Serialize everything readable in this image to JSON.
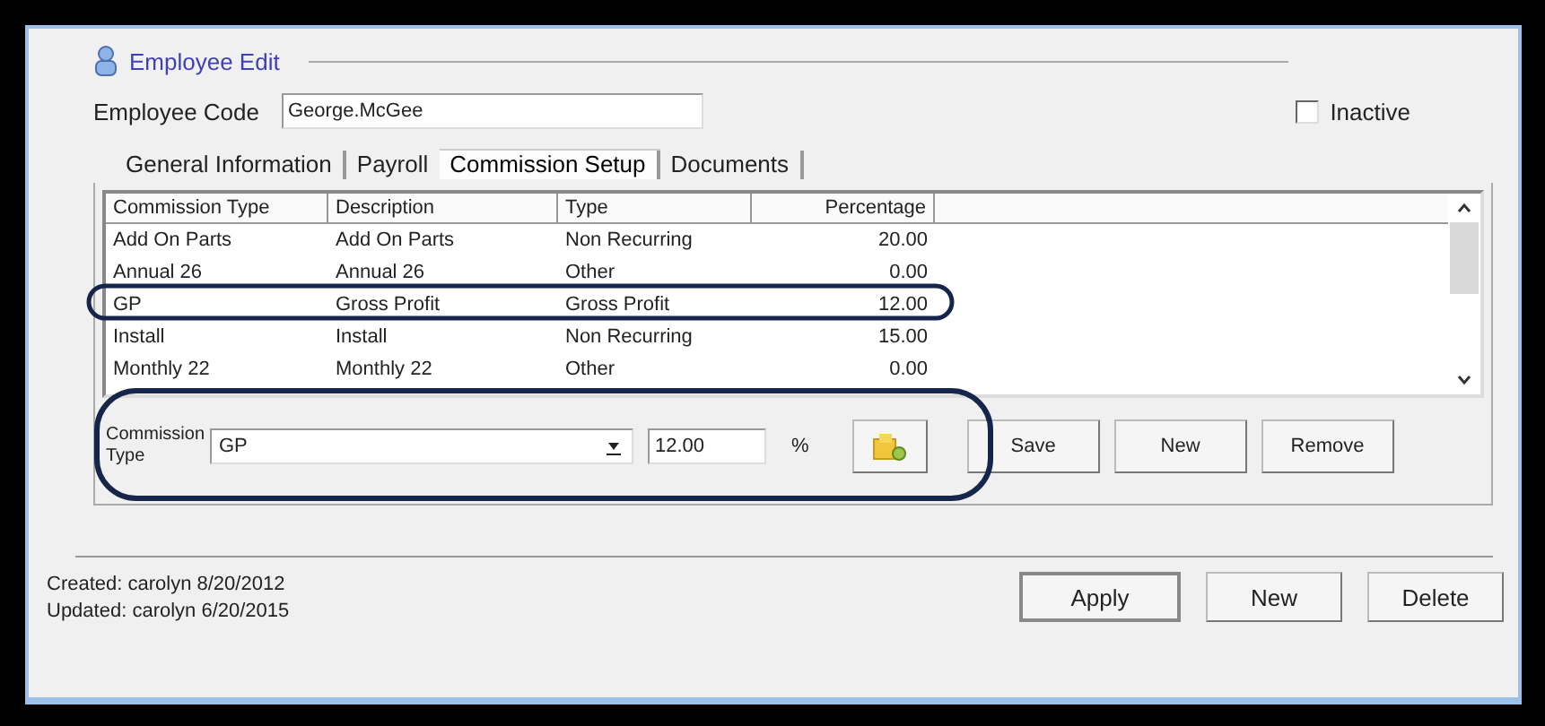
{
  "window": {
    "title": "Employee Edit"
  },
  "employee_code": {
    "label": "Employee Code",
    "value": "George.McGee"
  },
  "inactive": {
    "label": "Inactive",
    "checked": false
  },
  "tabs": [
    {
      "label": "General Information",
      "selected": false
    },
    {
      "label": "Payroll",
      "selected": false
    },
    {
      "label": "Commission Setup",
      "selected": true
    },
    {
      "label": "Documents",
      "selected": false
    }
  ],
  "table": {
    "columns": [
      "Commission Type",
      "Description",
      "Type",
      "Percentage"
    ],
    "rows": [
      [
        "Add On Parts",
        "Add On Parts",
        "Non Recurring",
        "20.00"
      ],
      [
        "Annual 26",
        "Annual 26",
        "Other",
        "0.00"
      ],
      [
        "GP",
        "Gross Profit",
        "Gross Profit",
        "12.00"
      ],
      [
        "Install",
        "Install",
        "Non Recurring",
        "15.00"
      ],
      [
        "Monthly 22",
        "Monthly 22",
        "Other",
        "0.00"
      ]
    ]
  },
  "editor": {
    "type_label": "Commission Type",
    "type_value": "GP",
    "percent_value": "12.00",
    "percent_sign": "%",
    "buttons": [
      "Save",
      "New",
      "Remove"
    ]
  },
  "audit": [
    "Created: carolyn 8/20/2012",
    "Updated: carolyn 6/20/2015"
  ],
  "buttons": [
    "Apply",
    "New",
    "Delete"
  ]
}
